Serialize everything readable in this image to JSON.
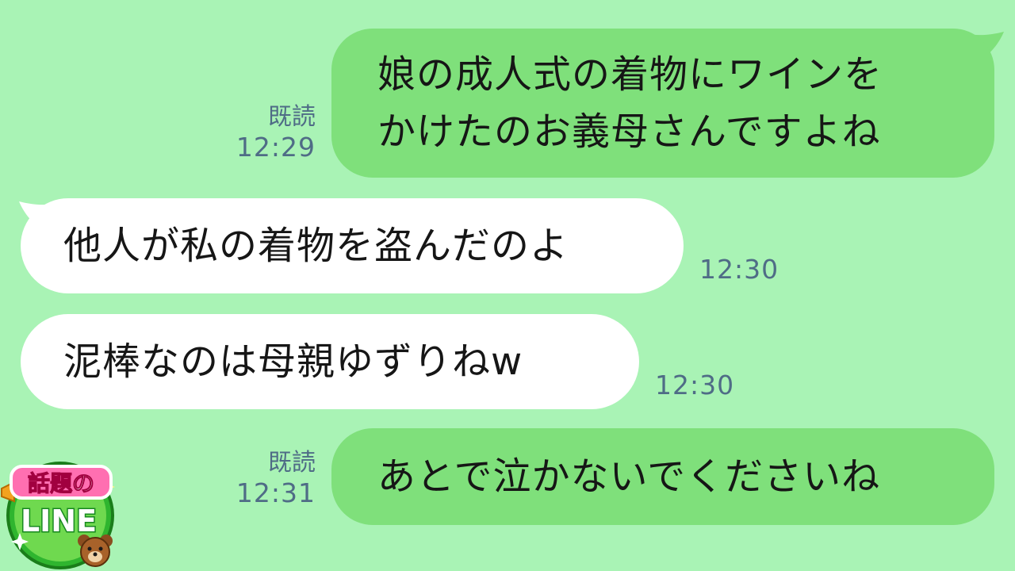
{
  "chat": {
    "background_color": "#a9f3b5",
    "sent_bubble_color": "#7fe07b",
    "received_bubble_color": "#ffffff",
    "meta_text_color": "#4f6c86",
    "messages": [
      {
        "direction": "sent",
        "lines": [
          "娘の成人式の着物にワインを",
          "かけたのお義母さんですよね"
        ],
        "read_label": "既読",
        "time": "12:29"
      },
      {
        "direction": "received",
        "lines": [
          "他人が私の着物を盗んだのよ"
        ],
        "time": "12:30"
      },
      {
        "direction": "received",
        "lines": [
          "泥棒なのは母親ゆずりねw"
        ],
        "time": "12:30"
      },
      {
        "direction": "sent",
        "lines": [
          "あとで泣かないでくださいね"
        ],
        "read_label": "既読",
        "time": "12:31"
      }
    ]
  },
  "logo": {
    "top_text": "話題の",
    "bottom_text": "LINE",
    "mascot_icon": "bear-icon"
  }
}
